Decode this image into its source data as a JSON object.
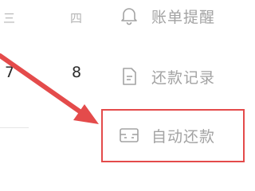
{
  "calendar": {
    "weekday_a": "三",
    "weekday_b": "四",
    "day_a": "7",
    "day_b": "8"
  },
  "menu": {
    "items": [
      {
        "label": "账单提醒",
        "icon": "bell-icon"
      },
      {
        "label": "还款记录",
        "icon": "document-icon"
      },
      {
        "label": "自动还款",
        "icon": "card-icon"
      }
    ]
  },
  "annotation": {
    "box_color": "#e44b4b",
    "arrow_color": "#e44b4b"
  }
}
